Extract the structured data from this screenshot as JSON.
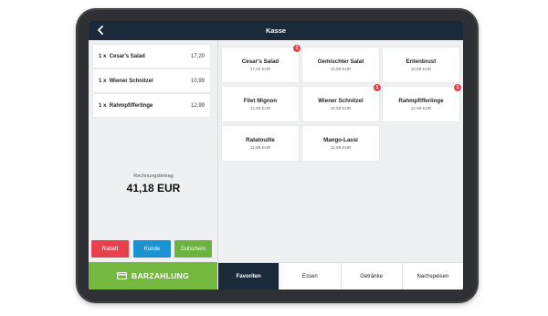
{
  "header": {
    "title": "Kasse",
    "back_icon": "chevron-left-icon"
  },
  "receipt": {
    "items": [
      {
        "qty": "1 x",
        "name": "Cesar's Salad",
        "price": "17,20"
      },
      {
        "qty": "1 x",
        "name": "Wiener Schnitzel",
        "price": "10,99"
      },
      {
        "qty": "1 x",
        "name": "Rahmpfifferlinge",
        "price": "12,99"
      }
    ],
    "total_label": "Rechnungsbetrag",
    "total_value": "41,18 EUR"
  },
  "actions": {
    "rabatt": "Rabatt",
    "kunde": "Kunde",
    "gutschein": "Gutschein"
  },
  "pay": {
    "label": "BARZAHLUNG",
    "icon": "card-icon"
  },
  "products": [
    {
      "name": "Cesar's Salad",
      "price": "17,20 EUR",
      "badge": "1"
    },
    {
      "name": "Gemischter Salat",
      "price": "10,99 EUR",
      "badge": ""
    },
    {
      "name": "Entenbrust",
      "price": "10,99 EUR",
      "badge": ""
    },
    {
      "name": "Filet Mignon",
      "price": "12,99 EUR",
      "badge": ""
    },
    {
      "name": "Wiener Schnitzel",
      "price": "10,99 EUR",
      "badge": "1"
    },
    {
      "name": "Rahmpfifferlinge",
      "price": "12,99 EUR",
      "badge": "1"
    },
    {
      "name": "Ratatouille",
      "price": "12,99 EUR",
      "badge": ""
    },
    {
      "name": "Mango-Lassi",
      "price": "12,99 EUR",
      "badge": ""
    }
  ],
  "tabs": [
    {
      "label": "Favoriten",
      "active": true
    },
    {
      "label": "Essen",
      "active": false
    },
    {
      "label": "Getränke",
      "active": false
    },
    {
      "label": "Nachspeisen",
      "active": false
    }
  ],
  "colors": {
    "header": "#1b2a3a",
    "rabatt": "#e5424d",
    "kunde": "#1a93d0",
    "gutschein": "#6cb33f",
    "pay": "#74b83f",
    "badge": "#e5424d"
  }
}
